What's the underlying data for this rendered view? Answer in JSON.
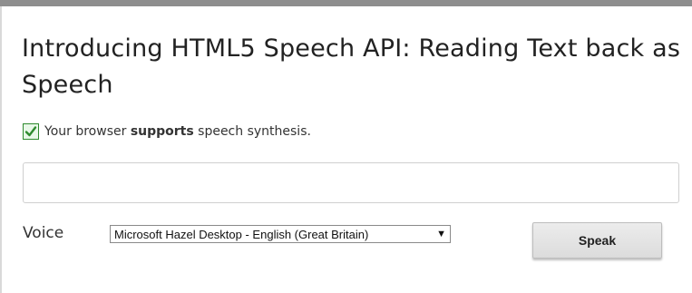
{
  "page": {
    "title": "Introducing HTML5 Speech API: Reading Text back as Speech"
  },
  "support": {
    "prefix": "Your browser ",
    "emphasis": "supports",
    "suffix": " speech synthesis."
  },
  "text_input": {
    "value": "",
    "placeholder": ""
  },
  "voice": {
    "label": "Voice",
    "selected": "Microsoft Hazel Desktop - English (Great Britain)"
  },
  "speak_button": {
    "label": "Speak"
  },
  "colors": {
    "top_bar": "#8e8e8e",
    "check_green": "#2e8b2e"
  },
  "icons": {
    "check": "check-icon",
    "dropdown": "chevron-down-icon"
  }
}
